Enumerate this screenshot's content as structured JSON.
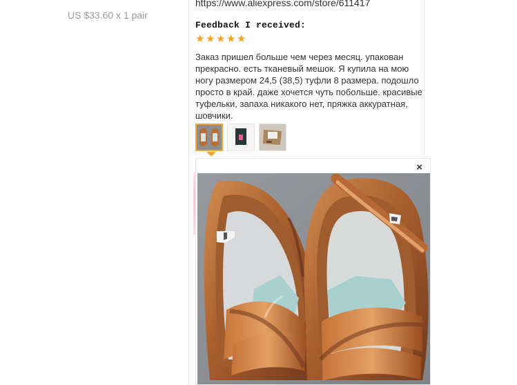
{
  "order": {
    "price_text": "US $33.60 x 1 pair"
  },
  "review": {
    "store_url": "https://www.aliexpress.com/store/611417",
    "feedback_title": "Feedback I received:",
    "rating": 5,
    "text": "Заказ пришел больше чем через месяц. упакован прекрасно. есть тканевый мешок. Я купила на мою ногу размером 24,5 (38,5) туфли 8 размера. подошло просто в край. даже хочется чуть побольше. красивые туфельки, запаха никакого нет, пряжка аккуратная, шовчики.",
    "thumbnails": [
      {
        "icon": "shoes-photo",
        "active": true
      },
      {
        "icon": "dust-bag-photo",
        "active": false
      },
      {
        "icon": "package-photo",
        "active": false
      }
    ],
    "preview": {
      "close_label": "×",
      "icon": "latin-dance-shoes-photo"
    }
  },
  "colors": {
    "star": "#f7a21b",
    "active_thumb_border": "#f0a63a",
    "muted_text": "#9b9b9b"
  }
}
